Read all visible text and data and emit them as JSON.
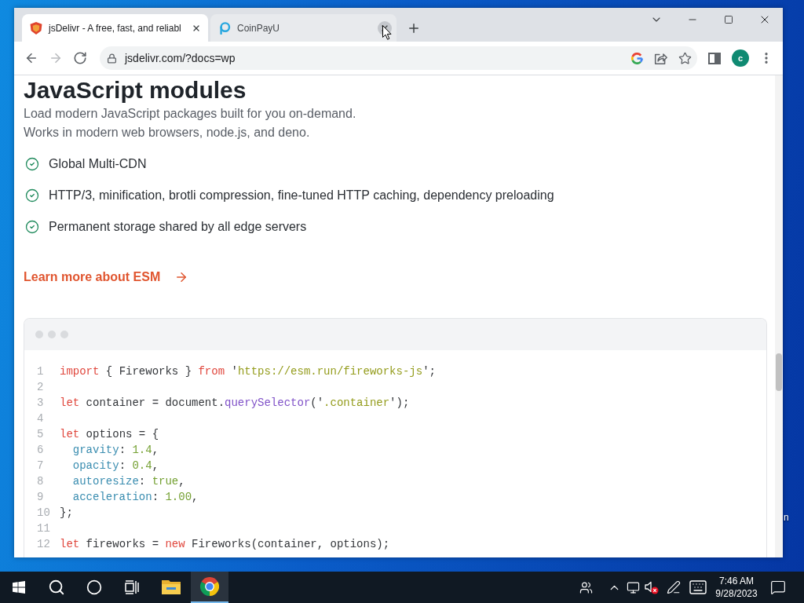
{
  "browser": {
    "tabs": [
      {
        "title": "jsDelivr - A free, fast, and reliabl",
        "kind": "shield",
        "selected": true,
        "close_hovered": false
      },
      {
        "title": "CoinPayU",
        "kind": "ring",
        "selected": false,
        "close_hovered": true
      }
    ],
    "nav_buttons": [
      {
        "kind": "back",
        "disabled": false
      },
      {
        "kind": "forward",
        "disabled": true
      },
      {
        "kind": "reload",
        "disabled": false
      }
    ],
    "address_bar": {
      "value": "jsdelivr.com/?docs=wp",
      "secure": true
    },
    "profile": {
      "initial": "c"
    }
  },
  "page": {
    "heading": "JavaScript modules",
    "description": [
      "Load modern JavaScript packages built for you on-demand.",
      "Works in modern web browsers, node.js, and deno."
    ],
    "features": [
      "Global Multi-CDN",
      "HTTP/3, minification, brotli compression, fine-tuned HTTP caching, dependency preloading",
      "Permanent storage shared by all edge servers"
    ],
    "link": "Learn more about ESM",
    "code": {
      "lines": [
        {
          "number": "1",
          "tokens": [
            {
              "kind": "keyword",
              "text": "import"
            },
            {
              "kind": "plain",
              "text": " { Fireworks } "
            },
            {
              "kind": "keyword",
              "text": "from"
            },
            {
              "kind": "plain",
              "text": " '"
            },
            {
              "kind": "string",
              "text": "https://esm.run/fireworks-js"
            },
            {
              "kind": "plain",
              "text": "';"
            }
          ]
        },
        {
          "number": "2"
        },
        {
          "number": "3",
          "tokens": [
            {
              "kind": "keyword",
              "text": "let"
            },
            {
              "kind": "plain",
              "text": " container = document."
            },
            {
              "kind": "method",
              "text": "querySelector"
            },
            {
              "kind": "plain",
              "text": "('"
            },
            {
              "kind": "string",
              "text": ".container"
            },
            {
              "kind": "plain",
              "text": "');"
            }
          ]
        },
        {
          "number": "4"
        },
        {
          "number": "5",
          "tokens": [
            {
              "kind": "keyword",
              "text": "let"
            },
            {
              "kind": "plain",
              "text": " options = {"
            }
          ]
        },
        {
          "number": "6",
          "tokens": [
            {
              "kind": "property",
              "text": "  gravity"
            },
            {
              "kind": "plain",
              "text": ": "
            },
            {
              "kind": "number",
              "text": "1.4"
            },
            {
              "kind": "plain",
              "text": ","
            }
          ]
        },
        {
          "number": "7",
          "tokens": [
            {
              "kind": "property",
              "text": "  opacity"
            },
            {
              "kind": "plain",
              "text": ": "
            },
            {
              "kind": "number",
              "text": "0.4"
            },
            {
              "kind": "plain",
              "text": ","
            }
          ]
        },
        {
          "number": "8",
          "tokens": [
            {
              "kind": "property",
              "text": "  autoresize"
            },
            {
              "kind": "plain",
              "text": ": "
            },
            {
              "kind": "number",
              "text": "true"
            },
            {
              "kind": "plain",
              "text": ","
            }
          ]
        },
        {
          "number": "9",
          "tokens": [
            {
              "kind": "property",
              "text": "  acceleration"
            },
            {
              "kind": "plain",
              "text": ": "
            },
            {
              "kind": "number",
              "text": "1.00"
            },
            {
              "kind": "plain",
              "text": ","
            }
          ]
        },
        {
          "number": "10",
          "tokens": [
            {
              "kind": "plain",
              "text": "};"
            }
          ]
        },
        {
          "number": "11"
        },
        {
          "number": "12",
          "tokens": [
            {
              "kind": "keyword",
              "text": "let"
            },
            {
              "kind": "plain",
              "text": " fireworks = "
            },
            {
              "kind": "keyword",
              "text": "new"
            },
            {
              "kind": "plain",
              "text": " Fireworks(container, options);"
            }
          ]
        }
      ]
    }
  },
  "taskbar": {
    "buttons": [
      {
        "kind": "start"
      },
      {
        "kind": "search"
      },
      {
        "kind": "cortana"
      },
      {
        "kind": "task-view"
      }
    ],
    "apps": [
      {
        "kind": "file-explorer",
        "active": false
      },
      {
        "kind": "chrome",
        "active": true
      }
    ],
    "tray": [
      {
        "kind": "people"
      },
      {
        "kind": "chevron"
      },
      {
        "kind": "network"
      },
      {
        "kind": "volume-muted"
      },
      {
        "kind": "pen"
      },
      {
        "kind": "keyboard"
      }
    ],
    "clock": {
      "time": "7:46 AM",
      "date": "9/28/2023"
    }
  },
  "desktop": {
    "icon_label": "n"
  }
}
